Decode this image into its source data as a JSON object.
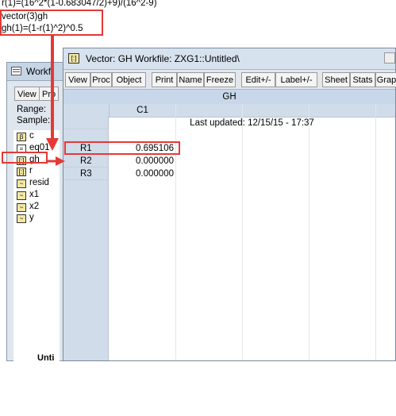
{
  "command_lines": [
    "r(1)=(16^2*(1-0.683047/2)+9)/(16^2-9)",
    "vector(3)gh",
    "gh(1)=(1-r(1)^2)^0.5"
  ],
  "workfile_window": {
    "title": "Workf",
    "buttons": [
      "View",
      "Pro"
    ],
    "range_label": "Range:",
    "sample_label": "Sample:",
    "objects": [
      {
        "name": "c",
        "icon": "coefficient-icon"
      },
      {
        "name": "eq01",
        "icon": "equation-icon"
      },
      {
        "name": "gh",
        "icon": "vector-icon"
      },
      {
        "name": "r",
        "icon": "vector-icon"
      },
      {
        "name": "resid",
        "icon": "series-icon"
      },
      {
        "name": "x1",
        "icon": "series-icon"
      },
      {
        "name": "x2",
        "icon": "series-icon"
      },
      {
        "name": "y",
        "icon": "series-icon"
      }
    ],
    "bottom_tab": "Unti"
  },
  "vector_window": {
    "title": "Vector: GH   Workfile: ZXG1::Untitled\\",
    "toolbar": [
      "View",
      "Proc",
      "Object",
      "Print",
      "Name",
      "Freeze",
      "Edit+/-",
      "Label+/-",
      "Sheet",
      "Stats",
      "Grap"
    ],
    "object_name": "GH",
    "column_header": "C1",
    "last_updated": "Last updated: 12/15/15 - 17:37",
    "rows": [
      {
        "label": "R1",
        "value": "0.695106"
      },
      {
        "label": "R2",
        "value": "0.000000"
      },
      {
        "label": "R3",
        "value": "0.000000"
      }
    ]
  },
  "colors": {
    "highlight": "#e53935",
    "accent": "#c8d8ea"
  }
}
